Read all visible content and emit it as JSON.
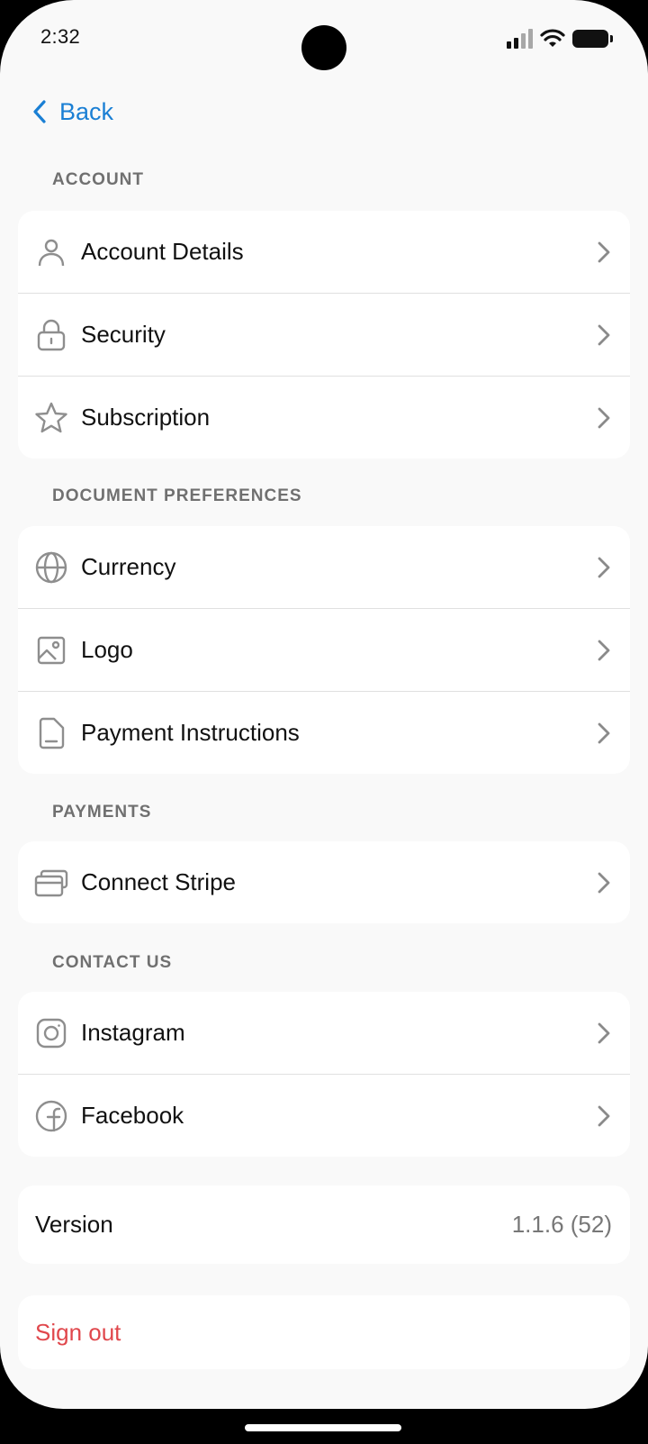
{
  "status": {
    "time": "2:32"
  },
  "nav": {
    "back_label": "Back"
  },
  "sections": {
    "account": {
      "title": "ACCOUNT",
      "items": [
        {
          "label": "Account Details",
          "icon": "person-icon"
        },
        {
          "label": "Security",
          "icon": "lock-icon"
        },
        {
          "label": "Subscription",
          "icon": "star-icon"
        }
      ]
    },
    "documents": {
      "title": "DOCUMENT PREFERENCES",
      "items": [
        {
          "label": "Currency",
          "icon": "globe-icon"
        },
        {
          "label": "Logo",
          "icon": "image-icon"
        },
        {
          "label": "Payment Instructions",
          "icon": "document-icon"
        }
      ]
    },
    "payments": {
      "title": "PAYMENTS",
      "items": [
        {
          "label": "Connect Stripe",
          "icon": "cards-icon"
        }
      ]
    },
    "contact": {
      "title": "CONTACT US",
      "items": [
        {
          "label": "Instagram",
          "icon": "instagram-icon"
        },
        {
          "label": "Facebook",
          "icon": "facebook-icon"
        }
      ]
    }
  },
  "version": {
    "label": "Version",
    "value": "1.1.6 (52)"
  },
  "signout": {
    "label": "Sign out"
  },
  "colors": {
    "accent": "#1a7fd4",
    "danger": "#e0474c",
    "background": "#f9f9f9",
    "icon": "#8e8e8e"
  }
}
